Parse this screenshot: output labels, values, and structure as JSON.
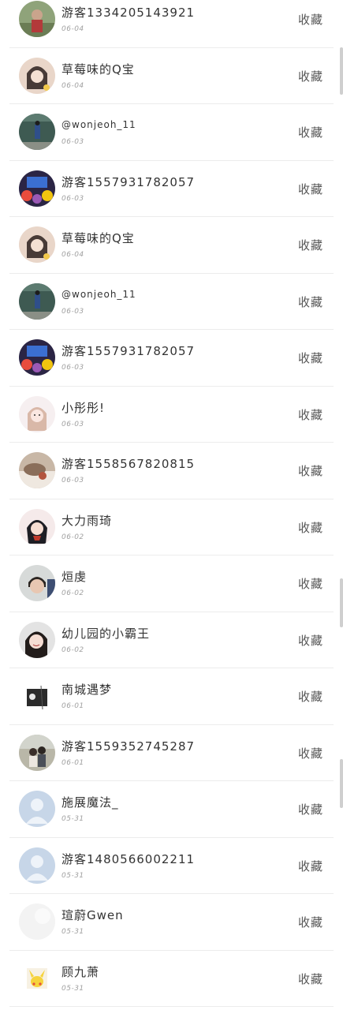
{
  "favorites_list": {
    "action_label": "收藏",
    "items": [
      {
        "name": "游客1334205143921",
        "date": "06-04",
        "avatar": "photo-outdoor"
      },
      {
        "name": "草莓味的Q宝",
        "date": "06-04",
        "avatar": "photo-girl-flower"
      },
      {
        "name": "@wonjeoh_11",
        "date": "06-03",
        "avatar": "photo-street"
      },
      {
        "name": "游客1557931782057",
        "date": "06-03",
        "avatar": "photo-colorful"
      },
      {
        "name": "草莓味的Q宝",
        "date": "06-04",
        "avatar": "photo-girl-flower"
      },
      {
        "name": "@wonjeoh_11",
        "date": "06-03",
        "avatar": "photo-street"
      },
      {
        "name": "游客1557931782057",
        "date": "06-03",
        "avatar": "photo-colorful"
      },
      {
        "name": "小彤彤!",
        "date": "06-03",
        "avatar": "photo-girl-light"
      },
      {
        "name": "游客1558567820815",
        "date": "06-03",
        "avatar": "photo-bed"
      },
      {
        "name": "大力雨琦",
        "date": "06-02",
        "avatar": "photo-girl-red"
      },
      {
        "name": "烜虔",
        "date": "06-02",
        "avatar": "photo-boy"
      },
      {
        "name": "幼儿园的小霸王",
        "date": "06-02",
        "avatar": "photo-girl-smile"
      },
      {
        "name": "南城遇梦",
        "date": "06-01",
        "avatar": "photo-bw"
      },
      {
        "name": "游客1559352745287",
        "date": "06-01",
        "avatar": "photo-couple"
      },
      {
        "name": "施展魔法_",
        "date": "05-31",
        "avatar": "default-user"
      },
      {
        "name": "游客1480566002211",
        "date": "05-31",
        "avatar": "default-user"
      },
      {
        "name": "瑄蔚Gwen",
        "date": "05-31",
        "avatar": "photo-blank"
      },
      {
        "name": "顾九萧",
        "date": "05-31",
        "avatar": "photo-pikachu"
      }
    ]
  }
}
